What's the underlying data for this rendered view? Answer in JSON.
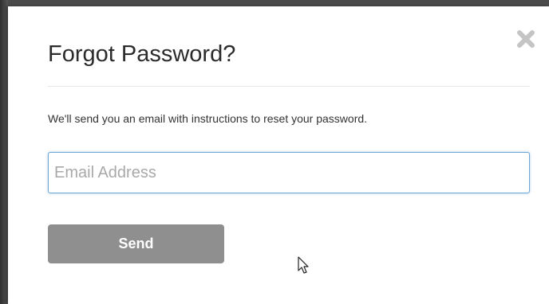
{
  "modal": {
    "title": "Forgot Password?",
    "description": "We'll send you an email with instructions to reset your password.",
    "close_icon": "close-x-icon"
  },
  "form": {
    "email_placeholder": "Email Address",
    "email_value": "",
    "send_label": "Send"
  },
  "colors": {
    "button_bg": "#8f8f8f",
    "input_focus_border": "#6ea6d6",
    "close_icon": "#c4c4c4",
    "backdrop": "#4a4a4a"
  }
}
